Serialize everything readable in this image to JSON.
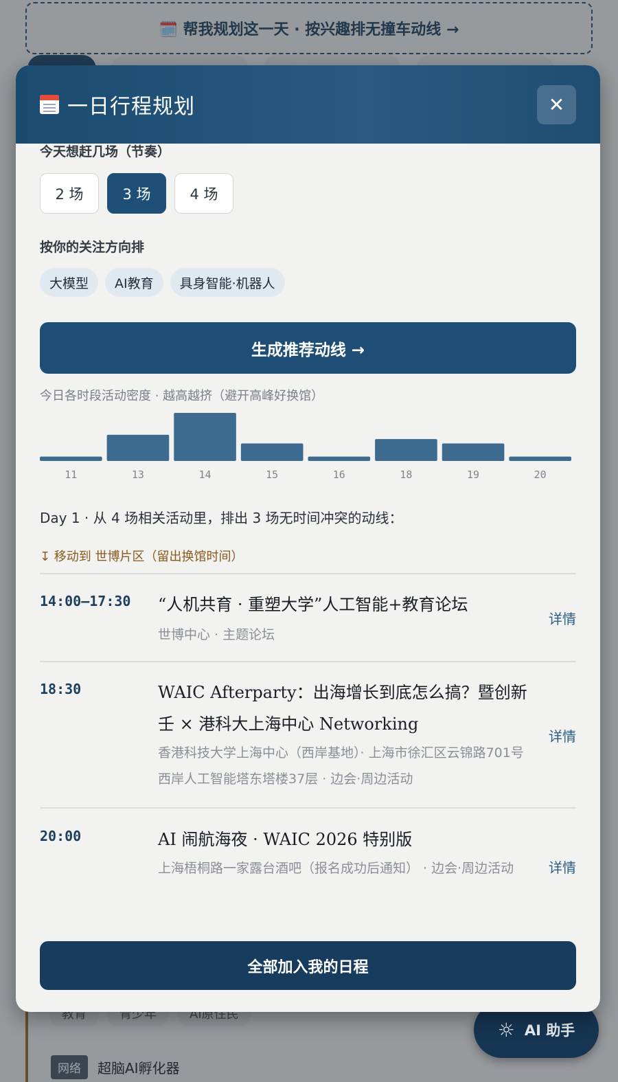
{
  "background": {
    "top_banner": "🗓️ 帮我规划这一天 · 按兴趣排无撞车动线 →",
    "tags": [
      "教育",
      "青少年",
      "AI原住民"
    ],
    "network_badge": "网络",
    "network_text": "超脑AI孵化器"
  },
  "ai_fab": {
    "icon": "sun-icon",
    "label": "AI 助手"
  },
  "modal": {
    "title": "一日行程规划",
    "close_label": "✕",
    "pace_label": "今天想赶几场（节奏）",
    "pace_options": [
      "2 场",
      "3 场",
      "4 场"
    ],
    "pace_selected": "3 场",
    "focus_label": "按你的关注方向排",
    "focus_tags": [
      "大模型",
      "AI教育",
      "具身智能·机器人"
    ],
    "generate_button": "生成推荐动线 →",
    "density_caption": "今日各时段活动密度 · 越高越挤（避开高峰好换馆）",
    "summary": "Day 1 · 从 4 场相关活动里，排出 3 场无时间冲突的动线：",
    "move_note": "↧ 移动到 世博片区（留出换馆时间）",
    "events": [
      {
        "time": "14:00–17:30",
        "title": "“人机共育 · 重塑大学”人工智能+教育论坛",
        "meta": "世博中心 · 主题论坛",
        "detail": "详情"
      },
      {
        "time": "18:30",
        "title": "WAIC Afterparty：出海增长到底怎么搞？暨创新壬 × 港科大上海中心 Networking",
        "meta": "香港科技大学上海中心（西岸基地）· 上海市徐汇区云锦路701号 西岸人工智能塔东塔楼37层 · 边会·周边活动",
        "detail": "详情"
      },
      {
        "time": "20:00",
        "title": "AI 闹航海夜 · WAIC 2026 特别版",
        "meta": "上海梧桐路一家露台酒吧（报名成功后通知） · 边会·周边活动",
        "detail": "详情"
      }
    ],
    "add_all_button": "全部加入我的日程"
  },
  "chart_data": {
    "type": "bar",
    "categories": [
      "11",
      "13",
      "14",
      "15",
      "16",
      "18",
      "19",
      "20"
    ],
    "values": [
      1,
      6,
      11,
      4,
      1,
      5,
      4,
      1
    ],
    "title": "",
    "xlabel": "",
    "ylabel": "",
    "ylim": [
      0,
      11
    ],
    "grid": false,
    "bar_color": "#3d6a8f"
  }
}
